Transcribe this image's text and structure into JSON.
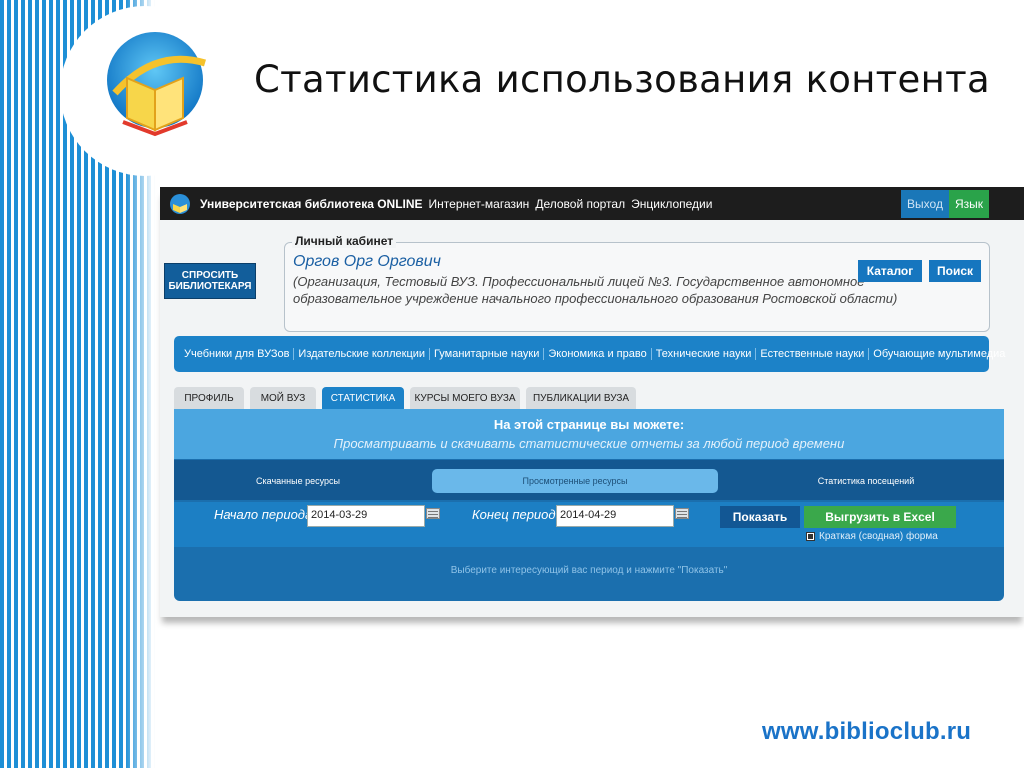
{
  "slide": {
    "title": "Статистика использования контента",
    "site_url": "www.biblioclub.ru"
  },
  "header": {
    "brand": "Университетская библиотека ONLINE",
    "links": [
      "Интернет-магазин",
      "Деловой портал",
      "Энциклопедии"
    ],
    "exit_label": "Выход",
    "lang_label": "Язык"
  },
  "ask_button": {
    "line1": "СПРОСИТЬ",
    "line2": "БИБЛИОТЕКАРЯ"
  },
  "cabinet": {
    "legend": "Личный кабинет",
    "user_name": "Оргов Орг Оргович",
    "org": "(Организация, Тестовый ВУЗ. Профессиональный лицей №3. Государственное автономное образовательное учреждение начального профессионального образования Ростовской области)",
    "catalog_label": "Каталог",
    "search_label": "Поиск"
  },
  "categories": [
    "Учебники для ВУЗов",
    "Издательские коллекции",
    "Гуманитарные науки",
    "Экономика и право",
    "Технические науки",
    "Естественные науки",
    "Обучающие мультимедиа"
  ],
  "tabs": [
    {
      "label": "ПРОФИЛЬ",
      "active": false
    },
    {
      "label": "МОЙ ВУЗ",
      "active": false
    },
    {
      "label": "СТАТИСТИКА",
      "active": true
    },
    {
      "label": "КУРСЫ МОЕГО ВУЗА",
      "active": false
    },
    {
      "label": "ПУБЛИКАЦИИ ВУЗА",
      "active": false
    }
  ],
  "panel": {
    "title": "На этой странице вы можете:",
    "subtitle": "Просматривать и скачивать статистические отчеты за любой период времени",
    "subtabs": [
      {
        "label": "Скачанные ресурсы",
        "active": false
      },
      {
        "label": "Просмотренные ресурсы",
        "active": true
      },
      {
        "label": "Статистика посещений",
        "active": false
      }
    ],
    "start_label": "Начало периода:",
    "start_value": "2014-03-29",
    "end_label": "Конец периода:",
    "end_value": "2014-04-29",
    "show_label": "Показать",
    "excel_label": "Выгрузить в Excel",
    "checkbox_label": "Краткая (сводная) форма",
    "checkbox_checked": true,
    "hint": "Выберите интересующий вас период и нажмите \"Показать\""
  },
  "colors": {
    "accent": "#1c82c8",
    "excel_green": "#3aa84b",
    "stripe_blue": "#1e8fd6"
  }
}
